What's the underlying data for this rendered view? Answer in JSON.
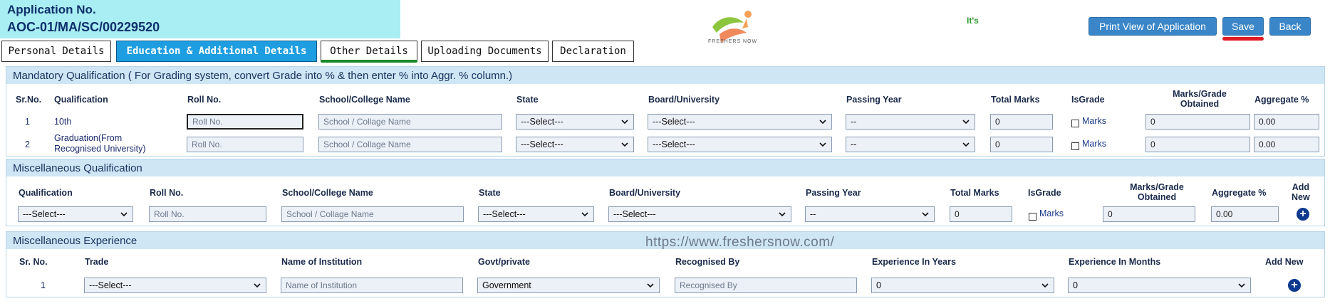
{
  "header": {
    "app_no_label": "Application No.",
    "app_no_value": "AOC-01/MA/SC/00229520",
    "logo_text": "FRESHERS NOW",
    "its_text": "It's",
    "buttons": {
      "print": "Print View of Application",
      "save": "Save",
      "back": "Back"
    }
  },
  "tabs": [
    "Personal Details",
    "Education & Additional Details",
    "Other Details",
    "Uploading Documents",
    "Declaration"
  ],
  "mandatory": {
    "title": "Mandatory Qualification ( For Grading system, convert Grade into % & then enter % into Aggr. % column.)",
    "headers": {
      "sr": "Sr.No.",
      "qual": "Qualification",
      "roll": "Roll No.",
      "school": "School/College Name",
      "state": "State",
      "board": "Board/University",
      "year": "Passing Year",
      "total": "Total Marks",
      "isgrade": "IsGrade",
      "marks_l1": "Marks/Grade",
      "marks_l2": "Obtained",
      "agg": "Aggregate %"
    },
    "rows": [
      {
        "sr": "1",
        "qual_l1": "10th",
        "qual_l2": "",
        "roll_ph": "Roll No.",
        "school_ph": "School / Collage Name",
        "state": "---Select---",
        "board": "---Select---",
        "year": "--",
        "total": "0",
        "chk_label": "Marks",
        "marks": "0",
        "agg": "0.00"
      },
      {
        "sr": "2",
        "qual_l1": "Graduation(From",
        "qual_l2": "Recognised University)",
        "roll_ph": "Roll No.",
        "school_ph": "School / Collage Name",
        "state": "---Select---",
        "board": "---Select---",
        "year": "--",
        "total": "0",
        "chk_label": "Marks",
        "marks": "0",
        "agg": "0.00"
      }
    ]
  },
  "misc_qual": {
    "title": "Miscellaneous Qualification",
    "headers": {
      "qual": "Qualification",
      "roll": "Roll No.",
      "school": "School/College Name",
      "state": "State",
      "board": "Board/University",
      "year": "Passing Year",
      "total": "Total Marks",
      "isgrade": "IsGrade",
      "marks_l1": "Marks/Grade",
      "marks_l2": "Obtained",
      "agg": "Aggregate %",
      "add_l1": "Add",
      "add_l2": "New"
    },
    "row": {
      "qual": "---Select---",
      "roll_ph": "Roll No.",
      "school_ph": "School / Collage Name",
      "state": "---Select---",
      "board": "---Select---",
      "year": "--",
      "total": "0",
      "chk_label": "Marks",
      "marks": "0",
      "agg": "0.00"
    }
  },
  "misc_exp": {
    "title": "Miscellaneous Experience",
    "headers": {
      "sr": "Sr. No.",
      "trade": "Trade",
      "inst": "Name of Institution",
      "govt": "Govt/private",
      "recog": "Recognised By",
      "years": "Experience In Years",
      "months": "Experience In Months",
      "add": "Add New"
    },
    "row": {
      "sr": "1",
      "trade": "---Select---",
      "inst_ph": "Name of Institution",
      "govt": "Government",
      "recog_ph": "Recognised By",
      "years": "0",
      "months": "0"
    }
  },
  "watermark": "https://www.freshersnow.com/"
}
